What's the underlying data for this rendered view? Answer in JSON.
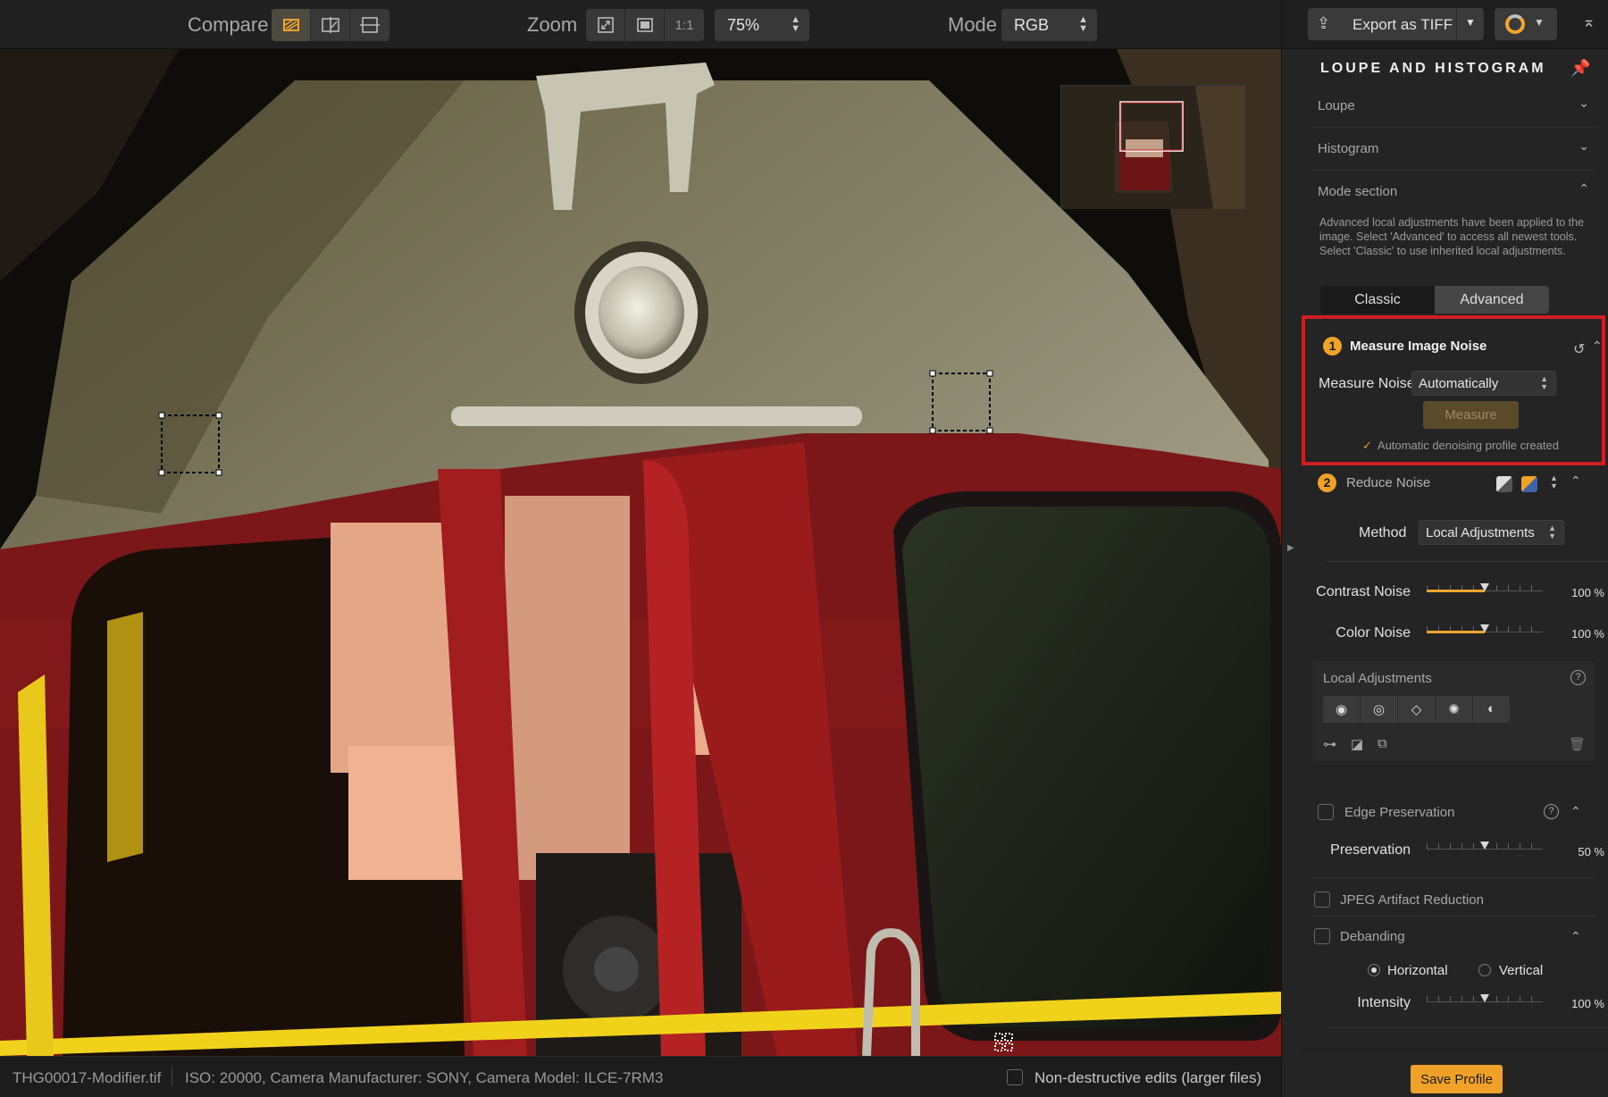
{
  "toolbar": {
    "compare_label": "Compare",
    "zoom_label": "Zoom",
    "zoom_one_to_one": "1:1",
    "zoom_value": "75%",
    "mode_label": "Mode",
    "mode_value": "RGB"
  },
  "status": {
    "filename": "THG00017-Modifier.tif",
    "metadata": "ISO: 20000, Camera Manufacturer: SONY, Camera Model: ILCE-7RM3",
    "non_destructive_label": "Non-destructive edits (larger files)"
  },
  "panel": {
    "export_label": "Export as TIFF",
    "title": "LOUPE AND HISTOGRAM",
    "sections": {
      "loupe": "Loupe",
      "histogram": "Histogram",
      "mode_section": "Mode section"
    },
    "mode_description": "Advanced local adjustments have been applied to the image. Select 'Advanced' to access all newest tools. Select 'Classic' to use inherited local adjustments.",
    "mode_options": {
      "classic": "Classic",
      "advanced": "Advanced",
      "selected": "Advanced"
    },
    "measure": {
      "number": "1",
      "title": "Measure Image Noise",
      "field_label": "Measure Noise",
      "field_value": "Automatically",
      "button_label": "Measure",
      "status_text": "Automatic denoising profile created"
    },
    "reduce": {
      "number": "2",
      "title": "Reduce Noise",
      "method_label": "Method",
      "method_value": "Local Adjustments",
      "contrast_label": "Contrast Noise",
      "contrast_value": "100 %",
      "contrast_level": 0.5,
      "color_label": "Color Noise",
      "color_value": "100 %",
      "color_level": 0.5
    },
    "local_adjustments": {
      "title": "Local Adjustments",
      "help": "?"
    },
    "edge": {
      "title": "Edge Preservation",
      "help": "?",
      "preservation_label": "Preservation",
      "preservation_value": "50 %",
      "preservation_level": 0.5
    },
    "jpeg": {
      "title": "JPEG Artifact Reduction"
    },
    "debanding": {
      "title": "Debanding",
      "horizontal_label": "Horizontal",
      "vertical_label": "Vertical",
      "selected": "Horizontal",
      "intensity_label": "Intensity",
      "intensity_value": "100 %",
      "intensity_level": 0.5
    },
    "save_label": "Save Profile"
  },
  "colors": {
    "accent": "#f4a52d",
    "highlight_box": "#d01e22",
    "panel_bg": "#242424"
  },
  "icons": {
    "compare": [
      "split-compare-icon",
      "side-by-side-icon",
      "stacked-compare-icon"
    ],
    "zoom": [
      "fit-screen-icon",
      "fill-screen-icon"
    ]
  }
}
